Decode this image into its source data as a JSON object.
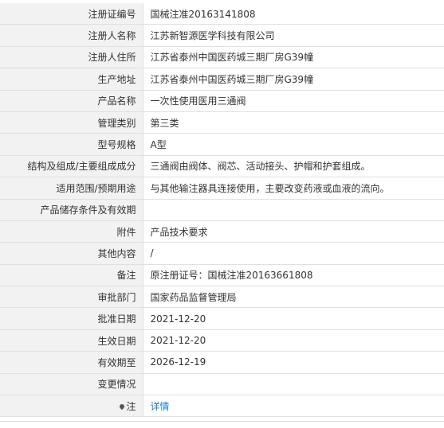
{
  "rows": [
    {
      "label": "注册证编号",
      "value": "国械注准20163141808"
    },
    {
      "label": "注册人名称",
      "value": "江苏新智源医学科技有限公司"
    },
    {
      "label": "注册人住所",
      "value": "江苏省泰州中国医药城三期厂房G39幢"
    },
    {
      "label": "生产地址",
      "value": "江苏省泰州中国医药城三期厂房G39幢"
    },
    {
      "label": "产品名称",
      "value": "一次性使用医用三通阀"
    },
    {
      "label": "管理类别",
      "value": "第三类"
    },
    {
      "label": "型号规格",
      "value": "A型"
    },
    {
      "label": "结构及组成/主要组成成分",
      "value": "三通阀由阀体、阀芯、活动接头、护帽和护套组成。"
    },
    {
      "label": "适用范围/预期用途",
      "value": "与其他输注器具连接使用，主要改变药液或血液的流向。"
    },
    {
      "label": "产品储存条件及有效期",
      "value": ""
    },
    {
      "label": "附件",
      "value": "产品技术要求"
    },
    {
      "label": "其他内容",
      "value": "/"
    },
    {
      "label": "备注",
      "value": "原注册证号：国械注准20163661808"
    },
    {
      "label": "审批部门",
      "value": "国家药品监督管理局"
    },
    {
      "label": "批准日期",
      "value": "2021-12-20"
    },
    {
      "label": "生效日期",
      "value": "2021-12-20"
    },
    {
      "label": "有效期至",
      "value": "2026-12-19"
    },
    {
      "label": "变更情况",
      "value": ""
    }
  ],
  "note_row": {
    "label": "注",
    "link_text": "详情"
  },
  "colors": {
    "label_bg": "#f2f2f2",
    "border": "#e0e0e0",
    "link": "#1a7dd6"
  }
}
